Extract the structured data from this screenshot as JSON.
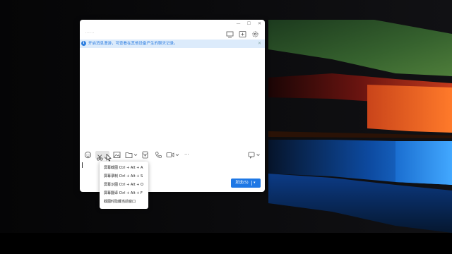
{
  "window": {
    "controls": {
      "minimize": "—",
      "maximize": "☐",
      "close": "✕"
    },
    "chat_name": "......",
    "header_icons": [
      "screen-share-icon",
      "add-member-icon",
      "settings-icon"
    ]
  },
  "banner": {
    "text_link": "开启",
    "text": "开启消息漫游，可查看在其他设备产生的聊天记录。",
    "close": "✕"
  },
  "toolbar": {
    "icons": [
      "emoji-icon",
      "scissors-icon",
      "image-icon",
      "folder-icon",
      "red-packet-icon",
      "phone-icon",
      "video-icon",
      "more-icon",
      "chat-history-icon"
    ],
    "more": "···"
  },
  "send": {
    "label": "发送(S)",
    "arrow": "▾"
  },
  "screenshot_menu": {
    "items": [
      "屏幕截图 Ctrl + Alt + A",
      "屏幕录制 Ctrl + Alt + S",
      "屏幕识图 Ctrl + Alt + O",
      "屏幕翻译 Ctrl + Alt + F",
      "截图时隐藏当前窗口"
    ]
  },
  "colors": {
    "accent": "#1f78e5",
    "banner_bg": "#dcebfb",
    "wallpaper_green": "#2f5a2a",
    "wallpaper_orange": "#f36b22",
    "wallpaper_blue": "#1a73d8"
  }
}
